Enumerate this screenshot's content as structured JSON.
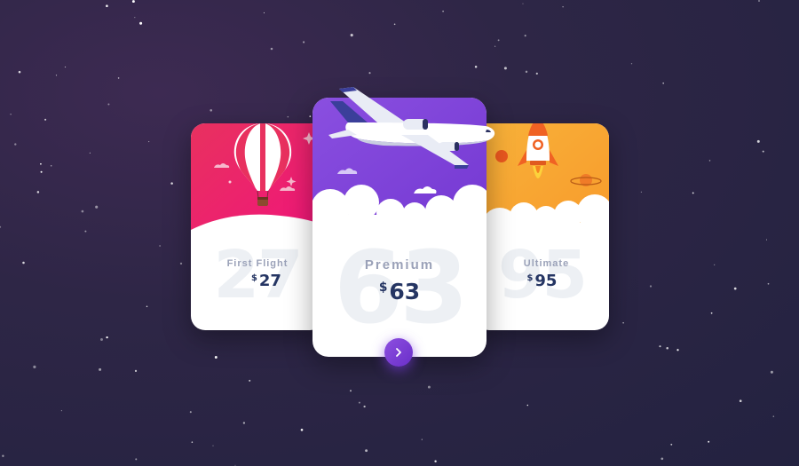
{
  "colors": {
    "background_dark": "#232240",
    "background_purple": "#3d2a52",
    "card_left_gradient": [
      "#e8315f",
      "#f0157a"
    ],
    "card_mid_gradient": [
      "#8a4fe0",
      "#7a3fd6"
    ],
    "card_right_gradient": [
      "#f7b23a",
      "#f99a2b"
    ],
    "price_text": "#253563",
    "plan_name_text": "#9aa1b8",
    "button": "#7a3fd6"
  },
  "cards": [
    {
      "plan": "First Flight",
      "currency": "$",
      "price": "27",
      "watermark": "27",
      "icon": "hot-air-balloon-icon"
    },
    {
      "plan": "Premium",
      "currency": "$",
      "price": "63",
      "watermark": "63",
      "icon": "airplane-icon",
      "action_icon": "chevron-right-icon"
    },
    {
      "plan": "Ultimate",
      "currency": "$",
      "price": "95",
      "watermark": "95",
      "icon": "rocket-icon"
    }
  ]
}
